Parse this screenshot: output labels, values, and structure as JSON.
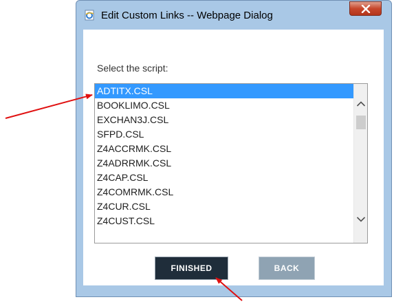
{
  "window": {
    "title": "Edit Custom Links -- Webpage Dialog",
    "icon": "ie-page-icon",
    "close_icon": "close-icon"
  },
  "dialog": {
    "prompt": "Select the script:",
    "scripts": [
      "ADTITX.CSL",
      "BOOKLIMO.CSL",
      "EXCHAN3J.CSL",
      "SFPD.CSL",
      "Z4ACCRMK.CSL",
      "Z4ADRRMK.CSL",
      "Z4CAP.CSL",
      "Z4COMRMK.CSL",
      "Z4CUR.CSL",
      "Z4CUST.CSL"
    ],
    "selected_index": 0,
    "finished_label": "FINISHED",
    "back_label": "BACK"
  },
  "colors": {
    "selection": "#3399ff",
    "finished_button": "#1f2d3a",
    "back_button": "#8fa3b3",
    "annotation_arrow": "#e01010"
  }
}
